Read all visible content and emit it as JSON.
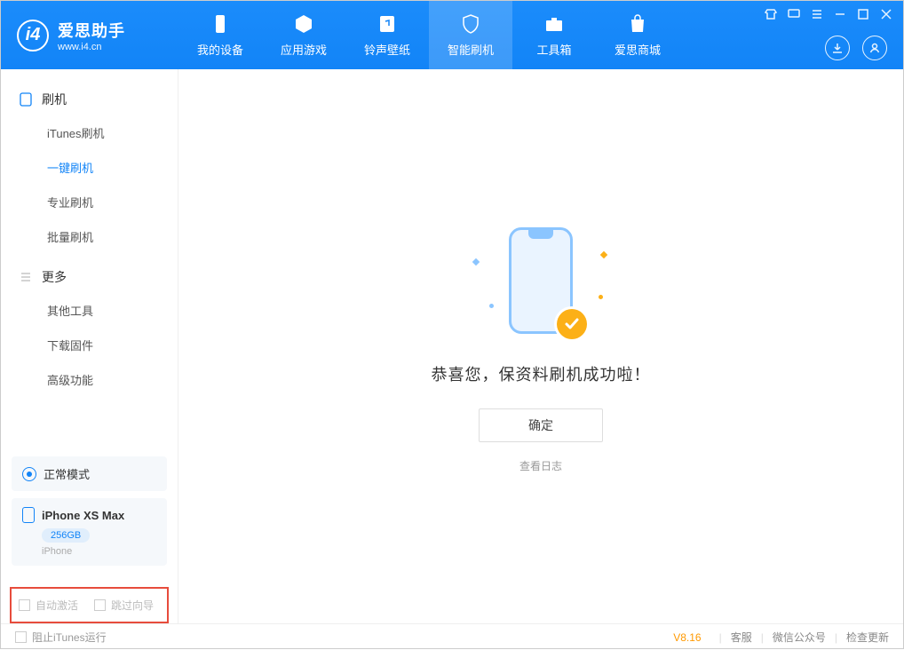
{
  "header": {
    "app_title": "爱思助手",
    "app_sub": "www.i4.cn",
    "tabs": [
      {
        "label": "我的设备"
      },
      {
        "label": "应用游戏"
      },
      {
        "label": "铃声壁纸"
      },
      {
        "label": "智能刷机"
      },
      {
        "label": "工具箱"
      },
      {
        "label": "爱思商城"
      }
    ]
  },
  "sidebar": {
    "group1_title": "刷机",
    "group1_items": [
      {
        "label": "iTunes刷机"
      },
      {
        "label": "一键刷机"
      },
      {
        "label": "专业刷机"
      },
      {
        "label": "批量刷机"
      }
    ],
    "group2_title": "更多",
    "group2_items": [
      {
        "label": "其他工具"
      },
      {
        "label": "下载固件"
      },
      {
        "label": "高级功能"
      }
    ],
    "mode_label": "正常模式",
    "device_name": "iPhone XS Max",
    "device_capacity": "256GB",
    "device_type": "iPhone",
    "cb_auto_activate": "自动激活",
    "cb_skip_guide": "跳过向导"
  },
  "main": {
    "success_msg": "恭喜您，保资料刷机成功啦！",
    "ok_btn": "确定",
    "view_log": "查看日志"
  },
  "footer": {
    "block_itunes": "阻止iTunes运行",
    "version": "V8.16",
    "link_service": "客服",
    "link_wechat": "微信公众号",
    "link_update": "检查更新"
  }
}
